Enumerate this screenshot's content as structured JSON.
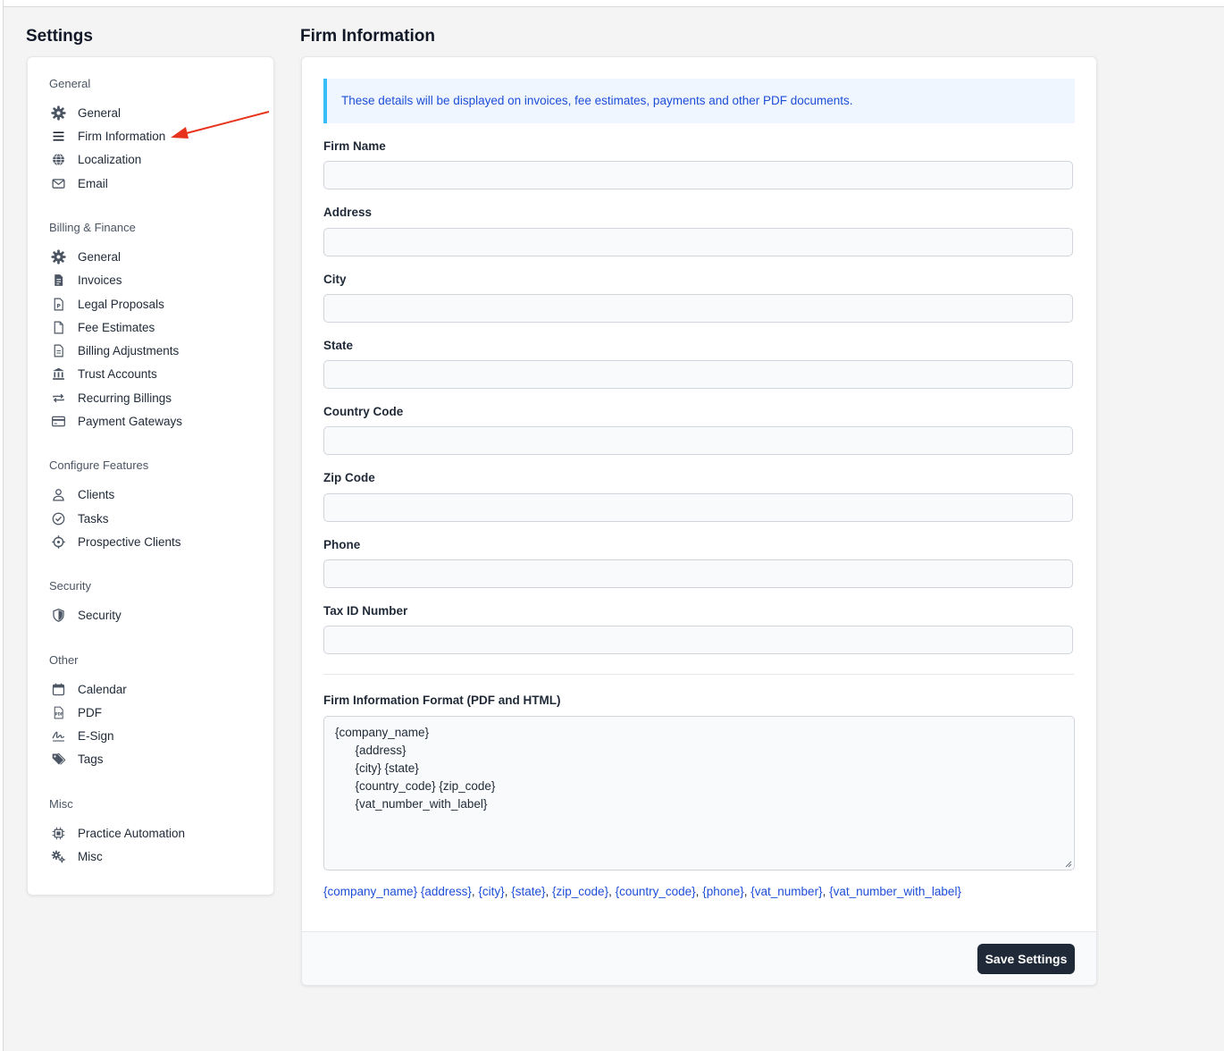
{
  "sidebar": {
    "title": "Settings",
    "groups": [
      {
        "heading": "General",
        "items": [
          {
            "label": "General",
            "icon": "gear-icon"
          },
          {
            "label": "Firm Information",
            "icon": "menu-lines-icon"
          },
          {
            "label": "Localization",
            "icon": "globe-icon"
          },
          {
            "label": "Email",
            "icon": "envelope-icon"
          }
        ]
      },
      {
        "heading": "Billing & Finance",
        "items": [
          {
            "label": "General",
            "icon": "gear-icon"
          },
          {
            "label": "Invoices",
            "icon": "invoice-icon"
          },
          {
            "label": "Legal Proposals",
            "icon": "proposal-document-icon"
          },
          {
            "label": "Fee Estimates",
            "icon": "document-icon"
          },
          {
            "label": "Billing Adjustments",
            "icon": "document-lines-icon"
          },
          {
            "label": "Trust Accounts",
            "icon": "bank-icon"
          },
          {
            "label": "Recurring Billings",
            "icon": "repeat-icon"
          },
          {
            "label": "Payment Gateways",
            "icon": "credit-card-icon"
          }
        ]
      },
      {
        "heading": "Configure Features",
        "items": [
          {
            "label": "Clients",
            "icon": "user-icon"
          },
          {
            "label": "Tasks",
            "icon": "check-circle-icon"
          },
          {
            "label": "Prospective Clients",
            "icon": "crosshair-icon"
          }
        ]
      },
      {
        "heading": "Security",
        "items": [
          {
            "label": "Security",
            "icon": "shield-icon"
          }
        ]
      },
      {
        "heading": "Other",
        "items": [
          {
            "label": "Calendar",
            "icon": "calendar-icon"
          },
          {
            "label": "PDF",
            "icon": "pdf-icon"
          },
          {
            "label": "E-Sign",
            "icon": "signature-icon"
          },
          {
            "label": "Tags",
            "icon": "tags-icon"
          }
        ]
      },
      {
        "heading": "Misc",
        "items": [
          {
            "label": "Practice Automation",
            "icon": "chip-icon"
          },
          {
            "label": "Misc",
            "icon": "cogs-icon"
          }
        ]
      }
    ]
  },
  "main": {
    "title": "Firm Information",
    "notice": "These details will be displayed on invoices, fee estimates, payments and other PDF documents.",
    "fields": [
      {
        "label": "Firm Name",
        "value": ""
      },
      {
        "label": "Address",
        "value": ""
      },
      {
        "label": "City",
        "value": ""
      },
      {
        "label": "State",
        "value": ""
      },
      {
        "label": "Country Code",
        "value": ""
      },
      {
        "label": "Zip Code",
        "value": ""
      },
      {
        "label": "Phone",
        "value": ""
      },
      {
        "label": "Tax ID Number",
        "value": ""
      }
    ],
    "format": {
      "label": "Firm Information Format (PDF and HTML)",
      "lines": [
        "{company_name}",
        "      {address}",
        "      {city} {state}",
        "      {country_code} {zip_code}",
        "      {vat_number_with_label}"
      ]
    },
    "placeholders": [
      "{company_name}",
      "{address}",
      "{city}",
      "{state}",
      "{zip_code}",
      "{country_code}",
      "{phone}",
      "{vat_number}",
      "{vat_number_with_label}"
    ],
    "save_label": "Save Settings"
  },
  "colors": {
    "accent_link": "#1d4ed8",
    "notice_bg": "#eff6ff",
    "notice_border": "#38bdf8",
    "button_bg": "#1f2937",
    "annotation_arrow": "#e8331c"
  }
}
